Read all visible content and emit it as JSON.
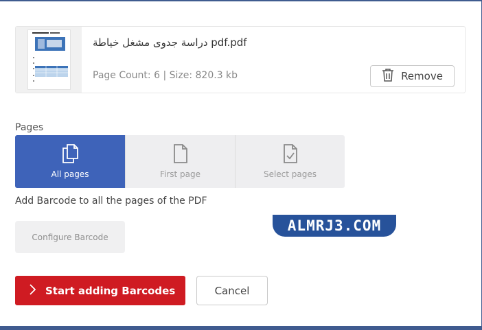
{
  "file": {
    "name": "دراسة جدوى مشغل خياطة pdf.pdf",
    "meta": "Page Count: 6  |  Size: 820.3 kb",
    "thumbnail_icon": "pdf-thumbnail"
  },
  "actions": {
    "remove_label": "Remove",
    "remove_icon": "trash-icon"
  },
  "pages": {
    "label": "Pages",
    "options": [
      {
        "label": "All pages",
        "icon": "copy-pages-icon",
        "active": true
      },
      {
        "label": "First page",
        "icon": "single-page-icon",
        "active": false
      },
      {
        "label": "Select pages",
        "icon": "page-check-icon",
        "active": false
      }
    ],
    "hint": "Add Barcode to all the pages of the PDF"
  },
  "configure_label": "Configure Barcode",
  "watermark": "ALMRJ3.COM",
  "footer": {
    "start_label": "Start adding Barcodes",
    "cancel_label": "Cancel"
  },
  "colors": {
    "accent": "#3e63b9",
    "primary_action": "#cf1b22",
    "watermark_bg": "#27529a"
  }
}
